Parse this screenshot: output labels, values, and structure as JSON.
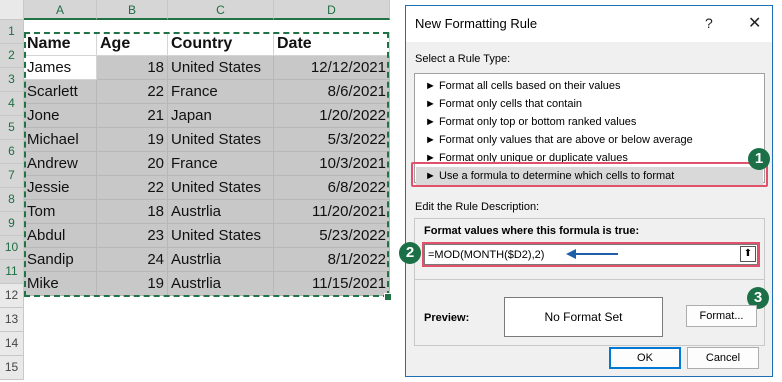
{
  "sheet": {
    "columns": [
      "A",
      "B",
      "C",
      "D"
    ],
    "rows": [
      "1",
      "2",
      "3",
      "4",
      "5",
      "6",
      "7",
      "8",
      "9",
      "10",
      "11",
      "12",
      "13",
      "14",
      "15"
    ],
    "header": [
      "Name",
      "Age",
      "Country",
      "Date"
    ],
    "data": [
      [
        "James",
        "18",
        "United States",
        "12/12/2021"
      ],
      [
        "Scarlett",
        "22",
        "France",
        "8/6/2021"
      ],
      [
        "Jone",
        "21",
        "Japan",
        "1/20/2022"
      ],
      [
        "Michael",
        "19",
        "United States",
        "5/3/2022"
      ],
      [
        "Andrew",
        "20",
        "France",
        "10/3/2021"
      ],
      [
        "Jessie",
        "22",
        "United States",
        "6/8/2022"
      ],
      [
        "Tom",
        "18",
        "Austrlia",
        "11/20/2021"
      ],
      [
        "Abdul",
        "23",
        "United States",
        "5/23/2022"
      ],
      [
        "Sandip",
        "24",
        "Austrlia",
        "8/1/2022"
      ],
      [
        "Mike",
        "19",
        "Austrlia",
        "11/15/2021"
      ]
    ]
  },
  "dialog": {
    "title": "New Formatting Rule",
    "help": "?",
    "close": "✕",
    "select_rule_type_label": "Select a Rule Type:",
    "rule_types": [
      "► Format all cells based on their values",
      "► Format only cells that contain",
      "► Format only top or bottom ranked values",
      "► Format only values that are above or below average",
      "► Format only unique or duplicate values",
      "► Use a formula to determine which cells to format"
    ],
    "selected_rule_index": 5,
    "edit_desc_label": "Edit the Rule Description:",
    "formula_label": "Format values where this formula is true:",
    "formula_value": "=MOD(MONTH($D2),2)",
    "collapse_glyph": "⬆",
    "preview_label": "Preview:",
    "preview_text": "No Format Set",
    "format_button": "Format...",
    "ok_button": "OK",
    "cancel_button": "Cancel"
  },
  "badges": [
    "1",
    "2",
    "3"
  ],
  "colors": {
    "badge": "#1c7047",
    "highlight": "#e0526c",
    "selection": "#217346",
    "arrow": "#1f5fa8"
  }
}
